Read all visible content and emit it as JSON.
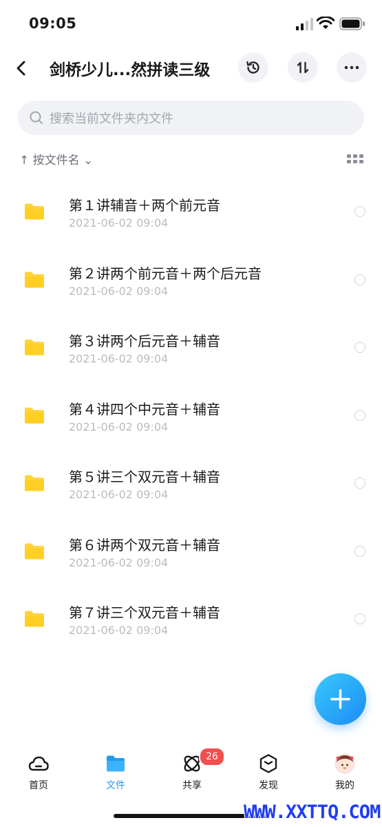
{
  "status_bar": {
    "time": "09:05"
  },
  "nav": {
    "title": "剑桥少儿...然拼读三级"
  },
  "search": {
    "placeholder": "搜索当前文件夹内文件"
  },
  "sort": {
    "label": "↑ 按文件名 ⌄"
  },
  "files": [
    {
      "name": "第１讲辅音＋两个前元音",
      "date": "2021-06-02 09:04"
    },
    {
      "name": "第２讲两个前元音＋两个后元音",
      "date": "2021-06-02 09:04"
    },
    {
      "name": "第３讲两个后元音＋辅音",
      "date": "2021-06-02 09:04"
    },
    {
      "name": "第４讲四个中元音＋辅音",
      "date": "2021-06-02 09:04"
    },
    {
      "name": "第５讲三个双元音＋辅音",
      "date": "2021-06-02 09:04"
    },
    {
      "name": "第６讲两个双元音＋辅音",
      "date": "2021-06-02 09:04"
    },
    {
      "name": "第７讲三个双元音＋辅音",
      "date": "2021-06-02 09:04"
    }
  ],
  "tabs": {
    "home": "首页",
    "files": "文件",
    "share": "共享",
    "share_badge": "26",
    "discover": "发现",
    "me": "我的"
  },
  "watermark": "WWW.XXTTQ.COM",
  "colors": {
    "accent": "#1e9bf0",
    "folder": "#ffd43b",
    "badge": "#f0504f"
  }
}
